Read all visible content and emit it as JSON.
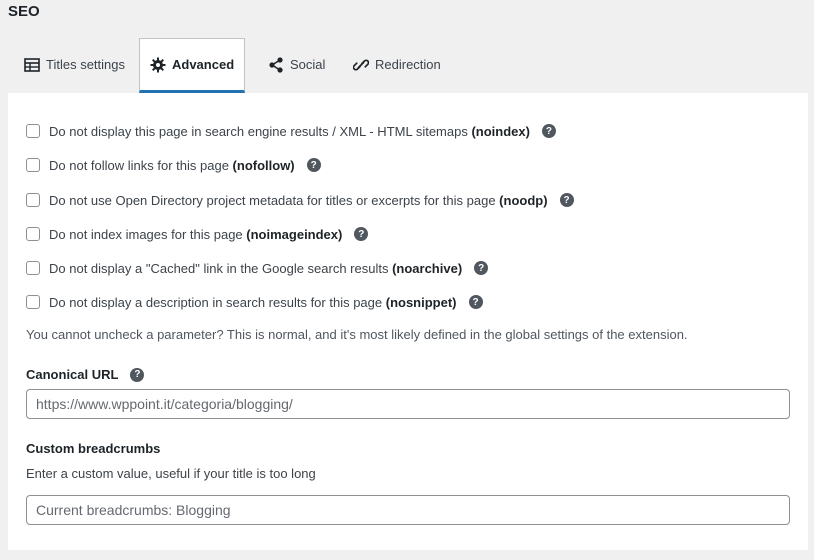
{
  "metabox": {
    "title": "SEO"
  },
  "tabs": [
    {
      "label": "Titles settings",
      "icon": "table-icon"
    },
    {
      "label": "Advanced",
      "icon": "gear-icon"
    },
    {
      "label": "Social",
      "icon": "share-icon"
    },
    {
      "label": "Redirection",
      "icon": "link-icon"
    }
  ],
  "options": [
    {
      "text": "Do not display this page in search engine results / XML - HTML sitemaps ",
      "key": "(noindex)",
      "checked": false
    },
    {
      "text": "Do not follow links for this page ",
      "key": "(nofollow)",
      "checked": false
    },
    {
      "text": "Do not use Open Directory project metadata for titles or excerpts for this page ",
      "key": "(noodp)",
      "checked": false
    },
    {
      "text": "Do not index images for this page ",
      "key": "(noimageindex)",
      "checked": false
    },
    {
      "text": "Do not display a \"Cached\" link in the Google search results ",
      "key": "(noarchive)",
      "checked": false
    },
    {
      "text": "Do not display a description in search results for this page ",
      "key": "(nosnippet)",
      "checked": false
    }
  ],
  "note": "You cannot uncheck a parameter? This is normal, and it's most likely defined in the global settings of the extension.",
  "help_glyph": "?",
  "canonical": {
    "label": "Canonical URL",
    "placeholder": "https://www.wppoint.it/categoria/blogging/",
    "value": ""
  },
  "breadcrumbs": {
    "label": "Custom breadcrumbs",
    "description": "Enter a custom value, useful if your title is too long",
    "placeholder": "Current breadcrumbs: Blogging",
    "value": ""
  },
  "colors": {
    "accent": "#2271b1",
    "panel": "#ffffff",
    "background": "#f0f0f1"
  }
}
